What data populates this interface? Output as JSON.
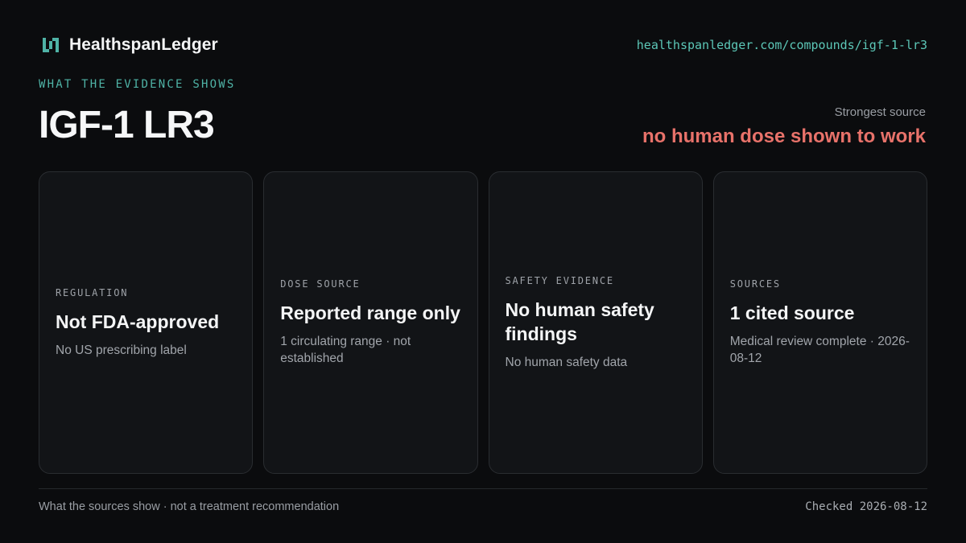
{
  "header": {
    "brand_name": "HealthspanLedger",
    "url": "healthspanledger.com/compounds/igf-1-lr3"
  },
  "hero": {
    "eyebrow": "WHAT THE EVIDENCE SHOWS",
    "title": "IGF-1 LR3",
    "strongest_source_label": "Strongest source",
    "strongest_source_value": "no human dose shown to work"
  },
  "cards": [
    {
      "label": "REGULATION",
      "value": "Not FDA-approved",
      "note": "No US prescribing label"
    },
    {
      "label": "DOSE SOURCE",
      "value": "Reported range only",
      "note": "1 circulating range · not established"
    },
    {
      "label": "SAFETY EVIDENCE",
      "value": "No human safety findings",
      "note": "No human safety data"
    },
    {
      "label": "SOURCES",
      "value": "1 cited source",
      "note": "Medical review complete · 2026-08-12"
    }
  ],
  "footer": {
    "disclaimer": "What the sources show · not a treatment recommendation",
    "checked": "Checked 2026-08-12"
  },
  "colors": {
    "accent": "#4fb3a6",
    "warning": "#e8726a",
    "background": "#0b0c0e",
    "card": "#121417"
  },
  "icons": {
    "brand": "ledger-logo-icon"
  }
}
